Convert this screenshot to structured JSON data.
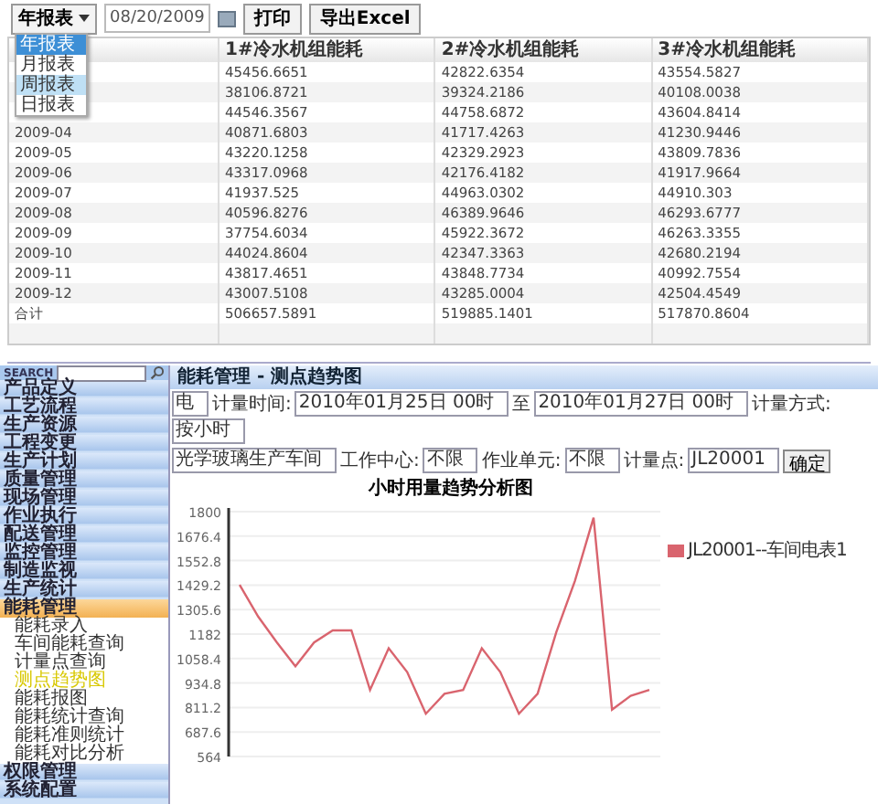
{
  "report": {
    "period_select": {
      "value": "年报表"
    },
    "date_field": {
      "value": "08/20/2009"
    },
    "buttons": [
      "打印",
      "导出Excel"
    ],
    "dropdown": {
      "options": [
        {
          "label": "年报表",
          "selected": true,
          "highlighted": false
        },
        {
          "label": "月报表",
          "selected": false,
          "highlighted": false
        },
        {
          "label": "周报表",
          "selected": false,
          "highlighted": true
        },
        {
          "label": "日报表",
          "selected": false,
          "highlighted": false
        }
      ]
    },
    "table": {
      "columns": [
        "1#冷水机组能耗",
        "2#冷水机组能耗",
        "3#冷水机组能耗"
      ],
      "rows": [
        {
          "values": [
            "45456.6651",
            "42822.6354",
            "43554.5827"
          ]
        },
        {
          "values": [
            "38106.8721",
            "39324.2186",
            "40108.0038"
          ]
        },
        {
          "values": [
            "44546.3567",
            "44758.6872",
            "43604.8414"
          ]
        },
        {
          "date": "2009-04",
          "values": [
            "40871.6803",
            "41717.4263",
            "41230.9446"
          ]
        },
        {
          "date": "2009-05",
          "values": [
            "43220.1258",
            "42329.2923",
            "43809.7836"
          ]
        },
        {
          "date": "2009-06",
          "values": [
            "43317.0968",
            "42176.4182",
            "41917.9664"
          ]
        },
        {
          "date": "2009-07",
          "values": [
            "41937.525",
            "44963.0302",
            "44910.303"
          ]
        },
        {
          "date": "2009-08",
          "values": [
            "40596.8276",
            "46389.9646",
            "46293.6777"
          ]
        },
        {
          "date": "2009-09",
          "values": [
            "37754.6034",
            "45922.3672",
            "46263.3355"
          ]
        },
        {
          "date": "2009-10",
          "values": [
            "44024.8604",
            "42347.3363",
            "42680.2194"
          ]
        },
        {
          "date": "2009-11",
          "values": [
            "43817.4651",
            "43848.7734",
            "40992.7554"
          ]
        },
        {
          "date": "2009-12",
          "values": [
            "43007.5108",
            "43285.0004",
            "42504.4549"
          ]
        },
        {
          "date": "合计",
          "values": [
            "506657.5891",
            "519885.1401",
            "517870.8604"
          ]
        }
      ]
    }
  },
  "app": {
    "sidebar": {
      "search_label": "SEARCH",
      "items": [
        {
          "label": "产品定义",
          "expanded": false
        },
        {
          "label": "工艺流程",
          "expanded": false
        },
        {
          "label": "生产资源",
          "expanded": false
        },
        {
          "label": "工程变更",
          "expanded": false
        },
        {
          "label": "生产计划",
          "expanded": false
        },
        {
          "label": "质量管理",
          "expanded": false
        },
        {
          "label": "现场管理",
          "expanded": false
        },
        {
          "label": "作业执行",
          "expanded": false
        },
        {
          "label": "配送管理",
          "expanded": false
        },
        {
          "label": "监控管理",
          "expanded": false
        },
        {
          "label": "制造监视",
          "expanded": false
        },
        {
          "label": "生产统计",
          "expanded": false
        },
        {
          "label": "能耗管理",
          "expanded": true,
          "children": [
            {
              "label": "能耗录入",
              "selected": false
            },
            {
              "label": "车间能耗查询",
              "selected": false
            },
            {
              "label": "计量点查询",
              "selected": false
            },
            {
              "label": "测点趋势图",
              "selected": true
            },
            {
              "label": "能耗报图",
              "selected": false
            },
            {
              "label": "能耗统计查询",
              "selected": false
            },
            {
              "label": "能耗准则统计",
              "selected": false
            },
            {
              "label": "能耗对比分析",
              "selected": false
            }
          ]
        },
        {
          "label": "权限管理",
          "expanded": false
        },
        {
          "label": "系统配置",
          "expanded": false
        }
      ]
    },
    "panel": {
      "title": "能耗管理 - 测点趋势图",
      "filters": [
        [
          {
            "kind": "select",
            "text": "电"
          },
          {
            "kind": "label",
            "text": "计量时间:"
          },
          {
            "kind": "select",
            "text": "2010年01月25日 00时"
          },
          {
            "kind": "label",
            "text": "至"
          },
          {
            "kind": "select",
            "text": "2010年01月27日 00时"
          },
          {
            "kind": "label",
            "text": "计量方式:"
          },
          {
            "kind": "select",
            "text": "按小时"
          }
        ],
        [
          {
            "kind": "select",
            "text": "光学玻璃生产车间"
          },
          {
            "kind": "label",
            "text": "工作中心:"
          },
          {
            "kind": "select",
            "text": "不限"
          },
          {
            "kind": "label",
            "text": "作业单元:"
          },
          {
            "kind": "select",
            "text": "不限"
          },
          {
            "kind": "label",
            "text": "计量点:"
          },
          {
            "kind": "select",
            "text": "JL20001"
          },
          {
            "kind": "button",
            "text": "确定"
          }
        ]
      ],
      "chart_data": {
        "type": "line",
        "title": "小时用量趋势分析图",
        "grid": true,
        "ylim": [
          564,
          1800
        ],
        "yticks": [
          564,
          687.6,
          811.2,
          934.8,
          1058.4,
          1182,
          1305.6,
          1429.2,
          1552.8,
          1676.4,
          1800
        ],
        "series": [
          {
            "name": "JL20001--车间电表1",
            "color": "#d9646e",
            "values": [
              1430,
              1270,
              1140,
              1020,
              1140,
              1200,
              1200,
              900,
              1110,
              990,
              780,
              880,
              900,
              1110,
              990,
              780,
              880,
              1190,
              1450,
              1770,
              800,
              870,
              900
            ]
          }
        ]
      }
    }
  }
}
